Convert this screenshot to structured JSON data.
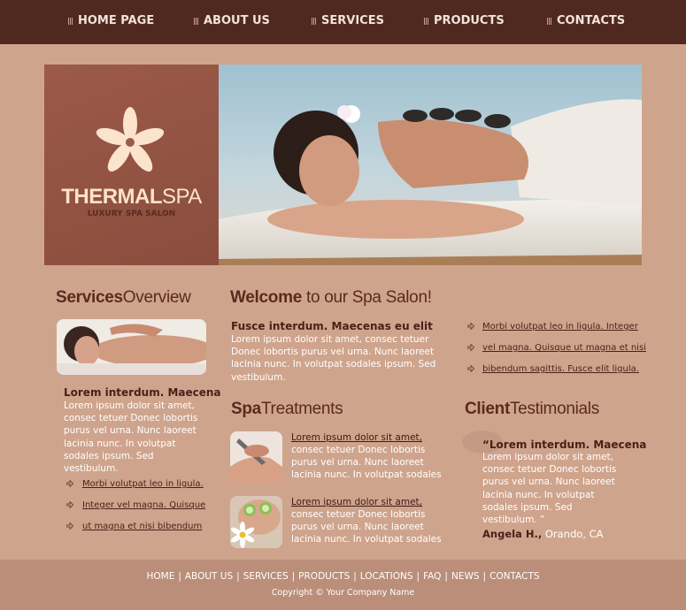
{
  "nav": {
    "items": [
      "HOME PAGE",
      "ABOUT US",
      "SERVICES",
      "PRODUCTS",
      "CONTACTS"
    ]
  },
  "logo": {
    "name_bold": "THERMAL",
    "name_light": "SPA",
    "tagline": "LUXURY SPA SALON"
  },
  "services": {
    "title_bold": "Services",
    "title_light": "Overview",
    "subheading": "Lorem interdum. Maecena",
    "text": "Lorem ipsum dolor sit amet, consec tetuer Donec lobortis purus vel urna. Nunc laoreet lacinia nunc. In volutpat sodales ipsum. Sed vestibulum.",
    "links": [
      "Morbi volutpat leo in ligula.",
      "Integer vel magna. Quisque",
      "ut magna et nisi bibendum "
    ]
  },
  "welcome": {
    "title_bold": "Welcome",
    "title_light": " to our Spa Salon!",
    "subheading": "Fusce interdum. Maecenas eu elit",
    "text": "Lorem ipsum dolor sit amet, consec tetuer Donec lobortis purus vel urna. Nunc laoreet lacinia nunc. In volutpat sodales ipsum. Sed vestibulum.",
    "links": [
      "Morbi volutpat leo in ligula. Integer",
      "vel magna. Quisque ut magna et nisi",
      "bibendum sagittis. Fusce elit ligula. "
    ]
  },
  "treatments": {
    "title_bold": "Spa",
    "title_light": "Treatments",
    "items": [
      {
        "link": "Lorem ipsum dolor sit amet,",
        "text": "consec tetuer Donec lobortis purus vel urna. Nunc laoreet lacinia nunc. In volutpat sodales"
      },
      {
        "link": "Lorem ipsum dolor sit amet,",
        "text": "consec tetuer Donec lobortis purus vel urna. Nunc laoreet lacinia nunc. In volutpat sodales"
      }
    ]
  },
  "testimonials": {
    "title_bold": "Client",
    "title_light": "Testimonials",
    "quote_head": "“Lorem interdum. Maecena",
    "quote_text": "Lorem ipsum dolor sit amet, consec tetuer Donec lobortis purus vel urna. Nunc laoreet lacinia nunc. In volutpat sodales ipsum. Sed vestibulum. ”",
    "author_name": "Angela H.,",
    "author_location": " Orando, CA"
  },
  "footer": {
    "links": [
      "HOME",
      "ABOUT US",
      "SERVICES",
      "PRODUCTS",
      "LOCATIONS",
      "FAQ",
      "NEWS",
      "CONTACTS"
    ],
    "separator": "|",
    "copyright": "Copyright © Your Company Name"
  },
  "colors": {
    "page_bg": "#cfa48c",
    "nav_bg": "#4f2820",
    "logo_panel": "#9c5a48",
    "heading": "#5a2a20",
    "footer_bg": "#ba8e78"
  },
  "icons": [
    "grip-icon",
    "flower-icon",
    "arrow-right-icon",
    "quote-bubble-icon"
  ]
}
